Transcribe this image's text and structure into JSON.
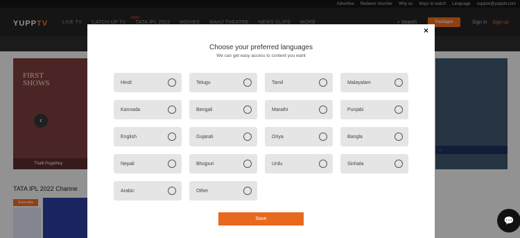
{
  "topbar": {
    "links": [
      "Advertise",
      "Redeem Voucher",
      "Why us",
      "Ways to watch",
      "Language",
      "support@yupptv.com"
    ]
  },
  "nav": {
    "logo_left": "YUPP",
    "logo_right": "TV",
    "new_tag": "NEW",
    "links": [
      "LIVE TV",
      "CATCH-UP TV",
      "TATA IPL 2022",
      "MOVIES",
      "MAHJ THEATRE",
      "NEWS CLIPS",
      "MORE"
    ],
    "search_label": "Search",
    "packages_label": "Packages",
    "signin_label": "Sign in",
    "signup_label": "Sign up"
  },
  "background": {
    "banner_title_line1": "FIRST",
    "banner_title_line2": "SHOWS",
    "banner_caption": "Thalli Pogathey",
    "ticker_text": "...",
    "section_title": "TATA IPL 2022 Channe",
    "subscribe_label": "Subscribe"
  },
  "modal": {
    "close_symbol": "×",
    "title": "Choose your preferred languages",
    "subtitle": "We can get easy access to content you want",
    "languages": [
      {
        "label": "Hindi"
      },
      {
        "label": "Telugu"
      },
      {
        "label": "Tamil"
      },
      {
        "label": "Malayalam"
      },
      {
        "label": "Kannada"
      },
      {
        "label": "Bengali"
      },
      {
        "label": "Marathi"
      },
      {
        "label": "Punjabi"
      },
      {
        "label": "English"
      },
      {
        "label": "Gujarati"
      },
      {
        "label": "Oriya"
      },
      {
        "label": "Bangla"
      },
      {
        "label": "Nepali"
      },
      {
        "label": "Bhojpuri"
      },
      {
        "label": "Urdu"
      },
      {
        "label": "Sinhala"
      },
      {
        "label": "Arabic"
      },
      {
        "label": "Other"
      }
    ],
    "save_label": "Save"
  },
  "colors": {
    "accent": "#e8681d",
    "option_bg": "#e5e5e5"
  },
  "icons": {
    "chat": "chat-bubble-icon",
    "close": "close-icon",
    "radio": "radio-circle-icon"
  }
}
